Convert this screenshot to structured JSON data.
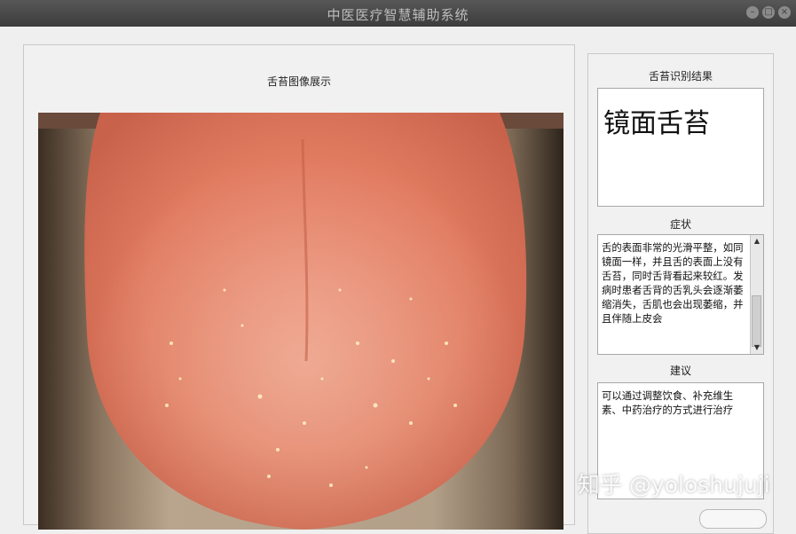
{
  "window": {
    "title": "中医医疗智慧辅助系统"
  },
  "left_panel": {
    "title": "舌苔图像展示"
  },
  "result": {
    "label": "舌苔识别结果",
    "value": "镜面舌苔"
  },
  "symptom": {
    "label": "症状",
    "text": "舌的表面非常的光滑平整，如同镜面一样，并且舌的表面上没有舌苔，同时舌背看起来较红。发病时患者舌背的舌乳头会逐渐萎缩消失，舌肌也会出现萎缩，并且伴随上皮会"
  },
  "advice": {
    "label": "建议",
    "text": "可以通过调整饮食、补充维生素、中药治疗的方式进行治疗"
  },
  "watermark": "知乎 @yoloshujuji",
  "colors": {
    "titlebar": "#3c3c3c",
    "tongue": "#e07a5f",
    "background": "#efefef"
  }
}
